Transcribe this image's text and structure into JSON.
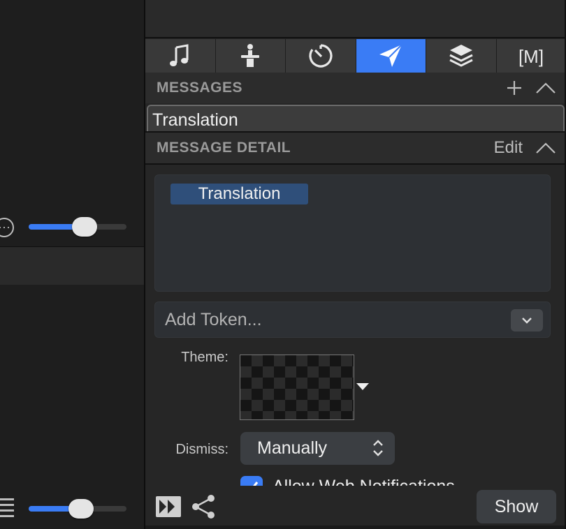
{
  "left": {
    "slider_top_value": 0.5,
    "slider_bottom_value": 0.5
  },
  "tabs": [
    {
      "icon": "music-note-icon",
      "active": false
    },
    {
      "icon": "person-icon",
      "active": false
    },
    {
      "icon": "timer-icon",
      "active": false
    },
    {
      "icon": "paper-plane-icon",
      "active": true
    },
    {
      "icon": "layers-icon",
      "active": false
    },
    {
      "icon": "metadata-icon",
      "label": "[M]",
      "active": false
    }
  ],
  "messages": {
    "title": "MESSAGES",
    "items": [
      "Translation"
    ]
  },
  "detail": {
    "title": "MESSAGE DETAIL",
    "edit_label": "Edit",
    "token": "Translation",
    "add_token_placeholder": "Add Token...",
    "theme_label": "Theme:",
    "dismiss_label": "Dismiss:",
    "dismiss_value": "Manually",
    "allow_web_label": "Allow Web Notifications",
    "allow_web_checked": true
  },
  "bottom": {
    "show_label": "Show"
  },
  "colors": {
    "accent": "#3a7cf5",
    "token_bg": "#2f4f7a"
  }
}
